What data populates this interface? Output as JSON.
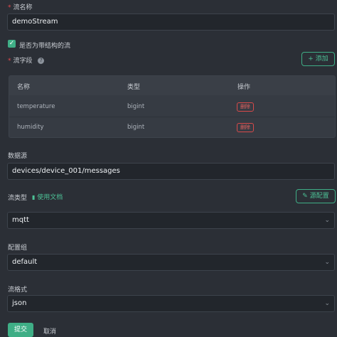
{
  "stream_name": {
    "label": "流名称",
    "value": "demoStream"
  },
  "structured": {
    "label": "是否为带结构的流",
    "checked": true
  },
  "fields": {
    "label": "流字段",
    "add_label": "添加",
    "columns": [
      "名称",
      "类型",
      "操作"
    ],
    "rows": [
      {
        "name": "temperature",
        "type": "bigint",
        "action": "删除"
      },
      {
        "name": "humidity",
        "type": "bigint",
        "action": "删除"
      }
    ]
  },
  "datasource": {
    "label": "数据源",
    "value": "devices/device_001/messages"
  },
  "stream_type": {
    "label": "流类型",
    "doc_link": "使用文档",
    "source_config": "源配置",
    "value": "mqtt"
  },
  "config_group": {
    "label": "配置组",
    "value": "default"
  },
  "stream_format": {
    "label": "流格式",
    "value": "json"
  },
  "actions": {
    "submit": "提交",
    "cancel": "取消"
  },
  "colors": {
    "accent": "#3fae86",
    "danger": "#e5484d",
    "background": "#2b2f36"
  }
}
